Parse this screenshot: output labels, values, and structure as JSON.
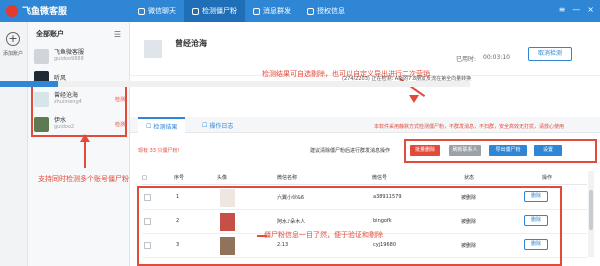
{
  "app": {
    "title": "飞鱼微客服"
  },
  "nav": {
    "tabs": [
      {
        "label": "微信聊天"
      },
      {
        "label": "检测僵尸粉"
      },
      {
        "label": "消息群发"
      },
      {
        "label": "授权信息"
      }
    ]
  },
  "sidebar": {
    "add_label": "添加账户"
  },
  "accounts": {
    "title": "全部账户",
    "items": [
      {
        "name": "飞鱼微客服",
        "sub": "guidoo9888",
        "status": ""
      },
      {
        "name": "听风",
        "sub": "",
        "status": ""
      },
      {
        "name": "曾经沧海",
        "sub": "zhuimeng4",
        "status": "检测"
      },
      {
        "name": "伊水",
        "sub": "guidoo2",
        "status": "检测"
      }
    ],
    "note": "支持同时检测多个账号僵尸粉"
  },
  "main": {
    "title": "曾经沧海",
    "time_label": "已用时:",
    "time_value": "00:03:10",
    "stop_button": "取消检测",
    "progress_text": "(274/2203) 正在检测: A新的7.8朋友反流在第全向量转换",
    "annotation_top": "检测结果可自选剔除，也可以自定义导出进行二次营销"
  },
  "content": {
    "tabs": [
      {
        "label": "检测结果"
      },
      {
        "label": "操作日志"
      }
    ],
    "tip": "本软件采用静默方式检测僵尸粉，不群发消息，不扫群，安全高效无打扰，请放心使用",
    "found_text": "现有 33 只僵尸粉!",
    "cleanup_tip": "建议清除僵尸粉后进行群发消息操作",
    "buttons": {
      "batch_delete": "批量删除",
      "refresh_contacts": "刷新联系人",
      "export": "导出僵尸粉",
      "settings": "设置"
    }
  },
  "table": {
    "headers": [
      "序号",
      "头像",
      "微信名称",
      "微信号",
      "状态",
      "操作"
    ],
    "rows": [
      {
        "no": "1",
        "name": "六翼小伙&6",
        "wid": "a38911579",
        "status": "被删除",
        "op": "删除"
      },
      {
        "no": "2",
        "name": "阿水♪朵木人",
        "wid": "bingofk",
        "status": "被删除",
        "op": "删除"
      },
      {
        "no": "3",
        "name": "2.13",
        "wid": "cyj19680",
        "status": "被删除",
        "op": "删除"
      }
    ],
    "note": "僵尸粉信息一目了然，便于验证和剔除"
  },
  "colors": {
    "primary": "#2f86d4",
    "danger": "#e24b3b"
  },
  "progress": {
    "value": 0.124
  }
}
